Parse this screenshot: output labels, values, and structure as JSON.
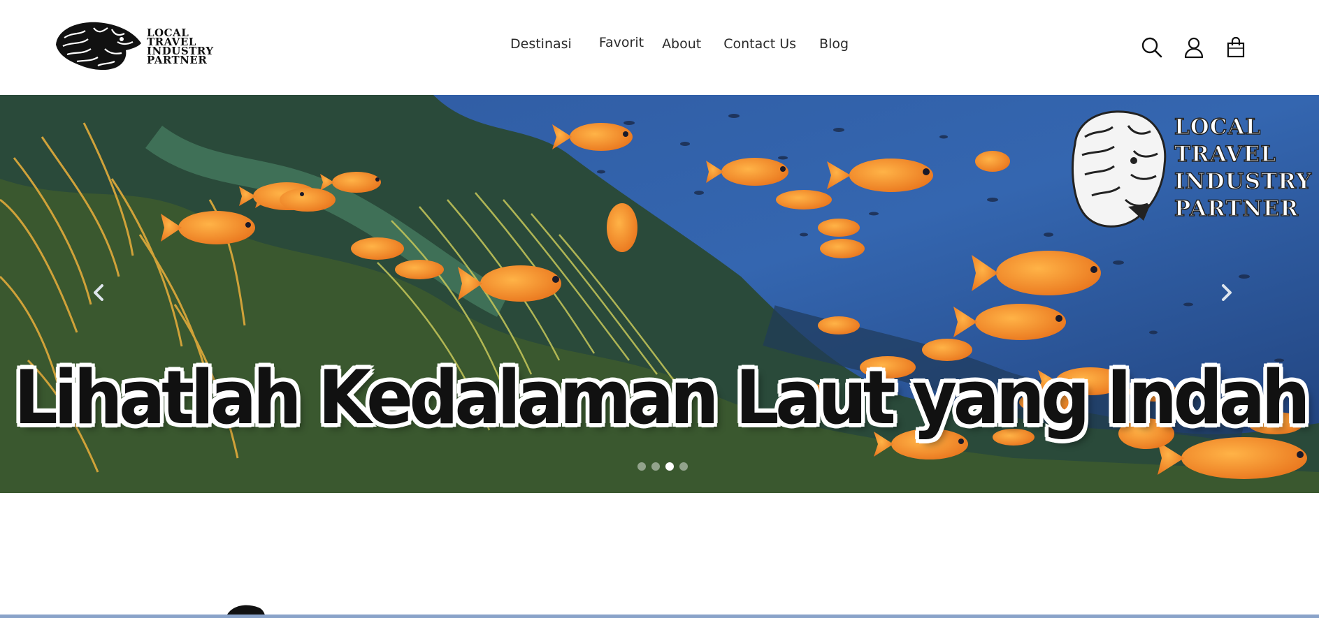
{
  "brand": {
    "logo_lines": [
      "LOCAL",
      "TRAVEL",
      "INDUSTRY",
      "PARTNER"
    ]
  },
  "nav": {
    "items": [
      {
        "label": "Destinasi"
      },
      {
        "label": "Favorit"
      },
      {
        "label": "About"
      },
      {
        "label": "Contact Us"
      },
      {
        "label": "Blog"
      }
    ]
  },
  "header_icons": [
    "search-icon",
    "user-icon",
    "shopping-bag-icon"
  ],
  "hero": {
    "headline": "Lihatlah Kedalaman Laut yang Indah",
    "watermark_lines": [
      "LOCAL",
      "TRAVEL",
      "INDUSTRY",
      "PARTNER"
    ],
    "slide_count": 4,
    "active_slide": 3,
    "prev_icon": "chevron-left-icon",
    "next_icon": "chevron-right-icon"
  },
  "colors": {
    "ocean": "#2d4f8e",
    "fish": "#f0892a",
    "accent_strip": "#8aa3c9"
  }
}
